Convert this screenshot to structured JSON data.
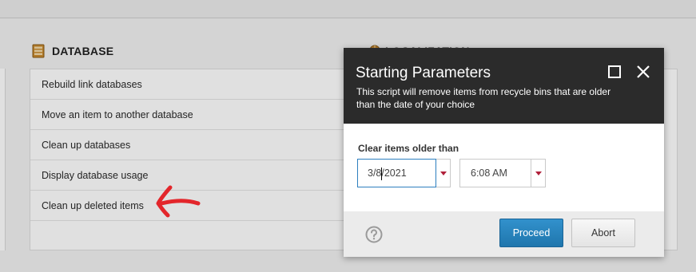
{
  "background": {
    "database_section": {
      "title": "DATABASE",
      "icon": "database-icon",
      "items": [
        {
          "label": "Rebuild link databases"
        },
        {
          "label": "Move an item to another database"
        },
        {
          "label": "Clean up databases"
        },
        {
          "label": "Display database usage"
        },
        {
          "label": "Clean up deleted items"
        }
      ]
    },
    "localization_section": {
      "title": "LOCALIZATION",
      "icon": "globe-icon"
    },
    "annotation": {
      "icon": "red-arrow-icon",
      "color": "#e3262b"
    }
  },
  "dialog": {
    "title": "Starting Parameters",
    "description": "This script will remove items from recycle bins that are older than the date of your choice",
    "field_label": "Clear items older than",
    "date_value": "3/8/2021",
    "time_value": "6:08 AM",
    "proceed_label": "Proceed",
    "abort_label": "Abort",
    "colors": {
      "header": "#2b2b2b",
      "primary": "#2b85c1",
      "dropdown_arrow": "#b0203a"
    }
  }
}
